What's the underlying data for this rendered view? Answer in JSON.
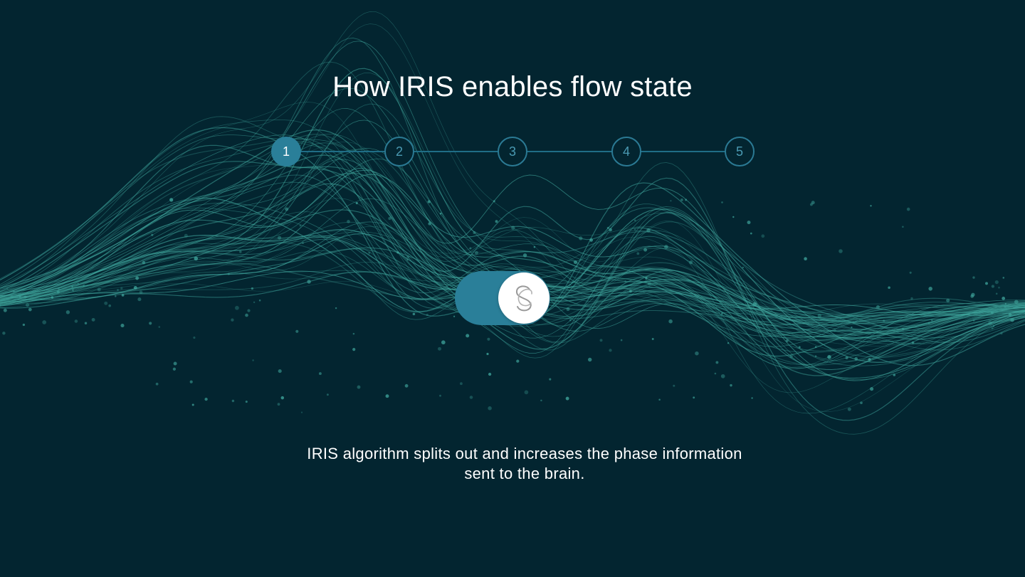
{
  "page": {
    "title": "How IRIS enables flow state"
  },
  "colors": {
    "background": "#032530",
    "wave": "#3fa59c",
    "accent": "#2a7f99",
    "step_border": "#2b7a94",
    "text": "#ffffff"
  },
  "stepper": {
    "active_step": 1,
    "steps": [
      {
        "label": "1"
      },
      {
        "label": "2"
      },
      {
        "label": "3"
      },
      {
        "label": "4"
      },
      {
        "label": "5"
      }
    ]
  },
  "toggle": {
    "state": "on",
    "knob_icon": "iris-logo-icon"
  },
  "caption": {
    "text": "IRIS algorithm splits out and increases the phase information sent to the brain."
  },
  "background_art": {
    "icon": "sound-wave-icon"
  }
}
